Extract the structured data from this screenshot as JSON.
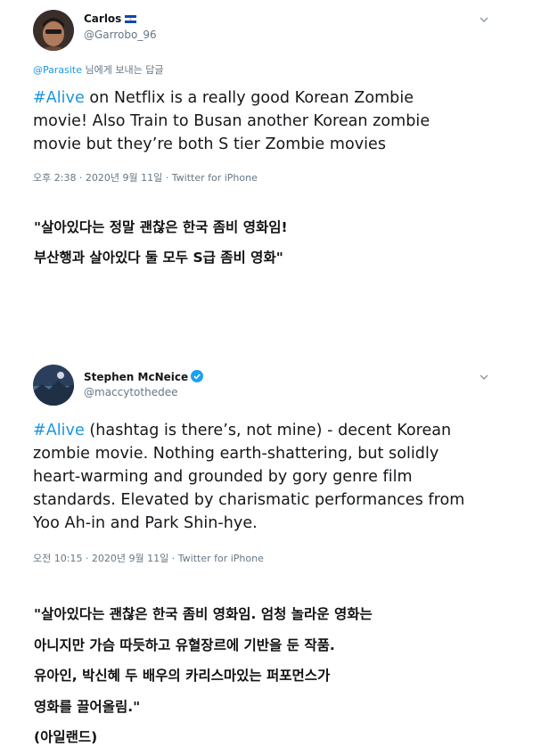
{
  "tweet1": {
    "display_name": "Carlos",
    "handle": "@Garrobo_96",
    "replying_mention": "@Parasite",
    "replying_suffix": " 님에게 보내는 답글",
    "hashtag": "#Alive",
    "text_line1_rest": " on Netflix is a really good Korean Zombie",
    "text_line2": "movie! Also Train to Busan another Korean zombie",
    "text_line3": "movie but they’re both S tier Zombie movies",
    "meta": "오후 2:38 · 2020년 9월 11일 · Twitter for iPhone",
    "flag_icon": "el-salvador-flag-icon"
  },
  "translation1": {
    "line1": "\"살아있다는 정말 괜찮은 한국 좀비 영화임!",
    "line2": "부산행과 살아있다 둘 모두 S급 좀비 영화\""
  },
  "tweet2": {
    "display_name": "Stephen McNeice",
    "handle": "@maccytothedee",
    "hashtag": "#Alive",
    "text_line1_rest": " (hashtag is there’s, not mine) - decent Korean",
    "text_line2": "zombie movie. Nothing earth-shattering, but solidly",
    "text_line3": "heart-warming and grounded by gory genre film",
    "text_line4": "standards. Elevated by charismatic performances from",
    "text_line5": "Yoo Ah-in and Park Shin-hye.",
    "meta": "오전 10:15 · 2020년 9월 11일 · Twitter for iPhone",
    "verified_icon": "verified-badge-icon"
  },
  "translation2": {
    "line1": "\"살아있다는 괜찮은 한국 좀비 영화임. 엄청 놀라운 영화는",
    "line2": "아니지만 가슴 따듯하고 유혈장르에 기반을 둔 작품.",
    "line3": "유아인, 박신혜 두 배우의 카리스마있는 퍼포먼스가",
    "line4": "영화를 끌어올림.\"",
    "line5": "(아일랜드)"
  },
  "colors": {
    "link": "#1b95e0",
    "text": "#14171a",
    "secondary": "#657786"
  }
}
